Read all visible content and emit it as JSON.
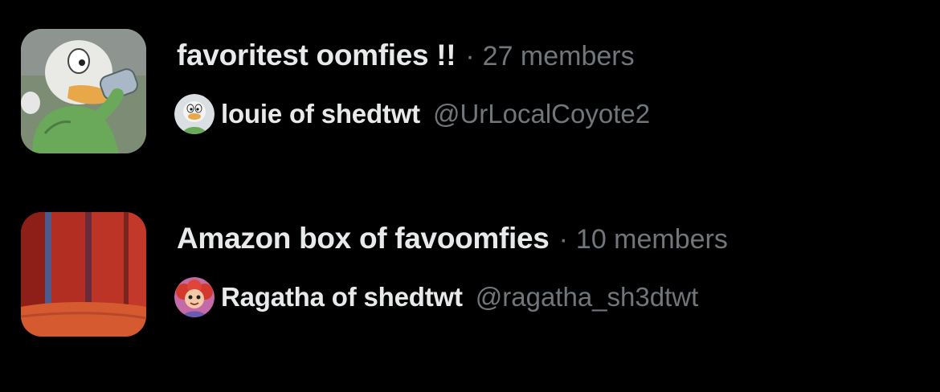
{
  "lists": [
    {
      "name": "favoritest oomfies !!",
      "separator": "·",
      "members": "27 members",
      "owner_name": "louie of shedtwt",
      "owner_handle": "@UrLocalCoyote2",
      "avatar_icon": "duck-cartoon-drinking-icon",
      "owner_avatar_icon": "duck-face-avatar-icon"
    },
    {
      "name": "Amazon box of favoomfies",
      "separator": "·",
      "members": "10 members",
      "owner_name": "Ragatha of shedtwt",
      "owner_handle": "@ragatha_sh3dtwt",
      "avatar_icon": "red-curtain-stage-icon",
      "owner_avatar_icon": "ragdoll-character-avatar-icon"
    }
  ],
  "colors": {
    "background": "#000000",
    "primary_text": "#e7e9ea",
    "secondary_text": "#71767b"
  }
}
